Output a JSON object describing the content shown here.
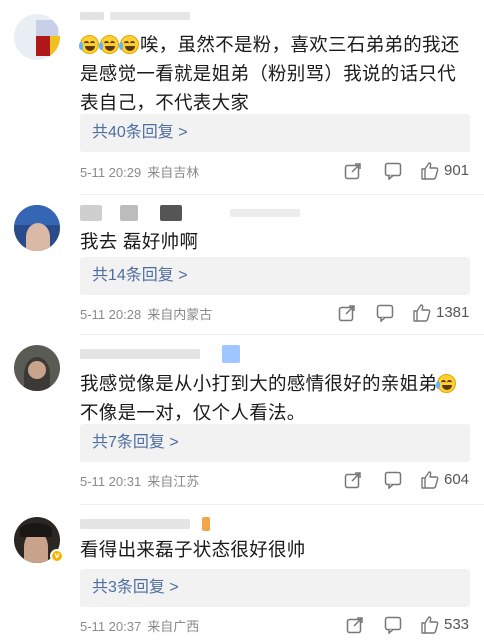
{
  "comments": [
    {
      "text_after_emoji": "唉，虽然不是粉，喜欢三石弟弟的我还是感觉一看就是姐弟（粉别骂）我说的话只代表自己，不代表大家",
      "replies_label": "共40条回复 >",
      "time": "5-11 20:29",
      "location": "来自吉林",
      "likes": "901"
    },
    {
      "text": "我去 磊好帅啊",
      "replies_label": "共14条回复 >",
      "time": "5-11 20:28",
      "location": "来自内蒙古",
      "likes": "1381"
    },
    {
      "text_before_emoji": "我感觉像是从小打到大的感情很好的亲姐弟",
      "text_after_emoji": "不像是一对，仅个人看法。",
      "replies_label": "共7条回复 >",
      "time": "5-11 20:31",
      "location": "来自江苏",
      "likes": "604"
    },
    {
      "text": "看得出来磊子状态很好很帅",
      "replies_label": "共3条回复 >",
      "time": "5-11 20:37",
      "location": "来自广西",
      "likes": "533"
    }
  ],
  "icons": {
    "emoji": "laugh-cry-emoji-icon",
    "forward": "share-icon",
    "comment": "comment-icon",
    "like": "thumbs-up-icon",
    "verified": "verified-badge-icon"
  },
  "colors": {
    "reply_link": "#4e6ea0",
    "meta_text": "#8a8a8a",
    "reply_bg": "#f2f2f2"
  }
}
